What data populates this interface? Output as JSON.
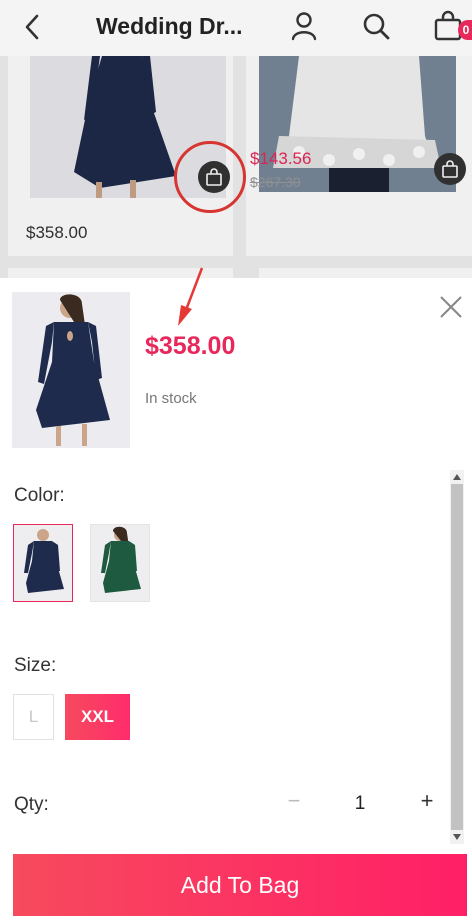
{
  "header": {
    "title": "Wedding Dr...",
    "back_icon": "chevron-left-icon",
    "user_icon": "user-icon",
    "search_icon": "search-icon",
    "bag_icon": "shopping-bag-icon",
    "bag_count": "0"
  },
  "grid": {
    "items": [
      {
        "price": "$358.00",
        "cart_icon": "shopping-bag-icon"
      },
      {
        "price": "$143.56",
        "old_price": "$267.30",
        "cart_icon": "shopping-bag-icon"
      }
    ]
  },
  "sheet": {
    "price": "$358.00",
    "stock": "In stock",
    "close_icon": "close-icon",
    "color_label": "Color:",
    "colors": [
      {
        "name": "navy",
        "selected": true
      },
      {
        "name": "green",
        "selected": false
      }
    ],
    "size_label": "Size:",
    "sizes": [
      {
        "label": "L",
        "available": false
      },
      {
        "label": "XXL",
        "selected": true
      }
    ],
    "qty_label": "Qty:",
    "qty_minus": "−",
    "qty_value": "1",
    "qty_plus": "+",
    "add_button": "Add To Bag"
  },
  "colors": {
    "accent": "#e8285a",
    "dark": "#333333",
    "annotation": "#e53935"
  }
}
